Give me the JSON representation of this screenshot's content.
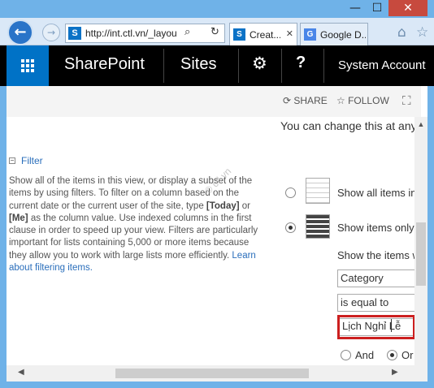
{
  "window": {
    "minimize": "—",
    "maximize": "☐",
    "close": "✕"
  },
  "browser": {
    "back_icon": "←",
    "forward_icon": "→",
    "address_favicon": "S",
    "address_url": "http://int.ctl.vn/_layou",
    "search_icon": "⌕",
    "refresh_icon": "↻",
    "tabs": [
      {
        "favicon": "S",
        "label": "Creat...",
        "close": "✕"
      },
      {
        "favicon": "G",
        "label": "Google D...",
        "close": ""
      }
    ],
    "home_icon": "⌂",
    "favorites_icon": "☆"
  },
  "suitebar": {
    "brand": "SharePoint",
    "sites": "Sites",
    "settings_icon": "⚙",
    "help_icon": "?",
    "account": "System Account"
  },
  "actionbar": {
    "share": "⟳ SHARE",
    "follow": "☆ FOLLOW",
    "focus_icon": "⛶"
  },
  "content": {
    "change_message": "You can change this at any ti",
    "filter_toggle": "−",
    "filter_heading": "Filter",
    "desc_part1": "Show all of the items in this view, or display a subset of the items by using filters. To filter on a column based on the current date or the current user of the site, type ",
    "desc_today": "[Today]",
    "desc_or": " or ",
    "desc_me": "[Me]",
    "desc_part2": " as the column value. Use indexed columns in the first clause in order to speed up your view. Filters are particularly important for lists containing 5,000 or more items because they allow you to work with large lists more efficiently. ",
    "desc_link": "Learn about filtering items.",
    "watermark": "© ctl.vn",
    "option_all": "Show all items in",
    "option_some": "Show items only",
    "show_items": "Show the items w",
    "column_value": "Category",
    "operator_value": "is equal to",
    "filter_value": "Lịch Nghỉ Lễ",
    "and_label": "And",
    "or_label": "Or"
  },
  "scrollbars": {
    "up_arrow": "▲",
    "left_arrow": "◀",
    "right_arrow": "▶"
  }
}
